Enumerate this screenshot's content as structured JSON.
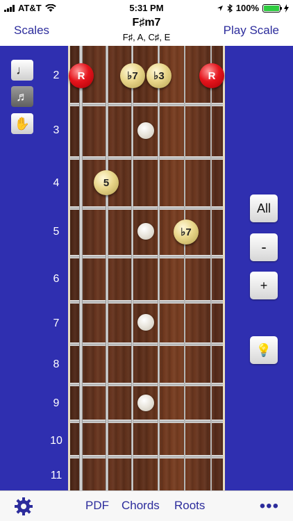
{
  "status_bar": {
    "carrier": "AT&T",
    "time": "5:31 PM",
    "battery": "100%"
  },
  "nav": {
    "left_button": "Scales",
    "title": "F♯m7",
    "subtitle": "F♯, A, C♯, E",
    "right_button": "Play Scale"
  },
  "tools": {
    "note_icon": "♩",
    "notes_icon": "♬",
    "hand_icon": "✋"
  },
  "frets": [
    "2",
    "3",
    "4",
    "5",
    "6",
    "7",
    "8",
    "9",
    "10",
    "11"
  ],
  "notes": {
    "r1": "R",
    "b7a": "♭7",
    "b3": "♭3",
    "r2": "R",
    "five": "5",
    "b7b": "♭7"
  },
  "side_buttons": {
    "all": "All",
    "minus": "-",
    "plus": "+",
    "light": "💡"
  },
  "tab_bar": {
    "pdf": "PDF",
    "chords": "Chords",
    "roots": "Roots",
    "more": "•••"
  },
  "colors": {
    "background": "#2f2fb0",
    "root_note": "#e4141c",
    "chord_tone": "#e9d68a",
    "accent": "#2c2c9c"
  }
}
